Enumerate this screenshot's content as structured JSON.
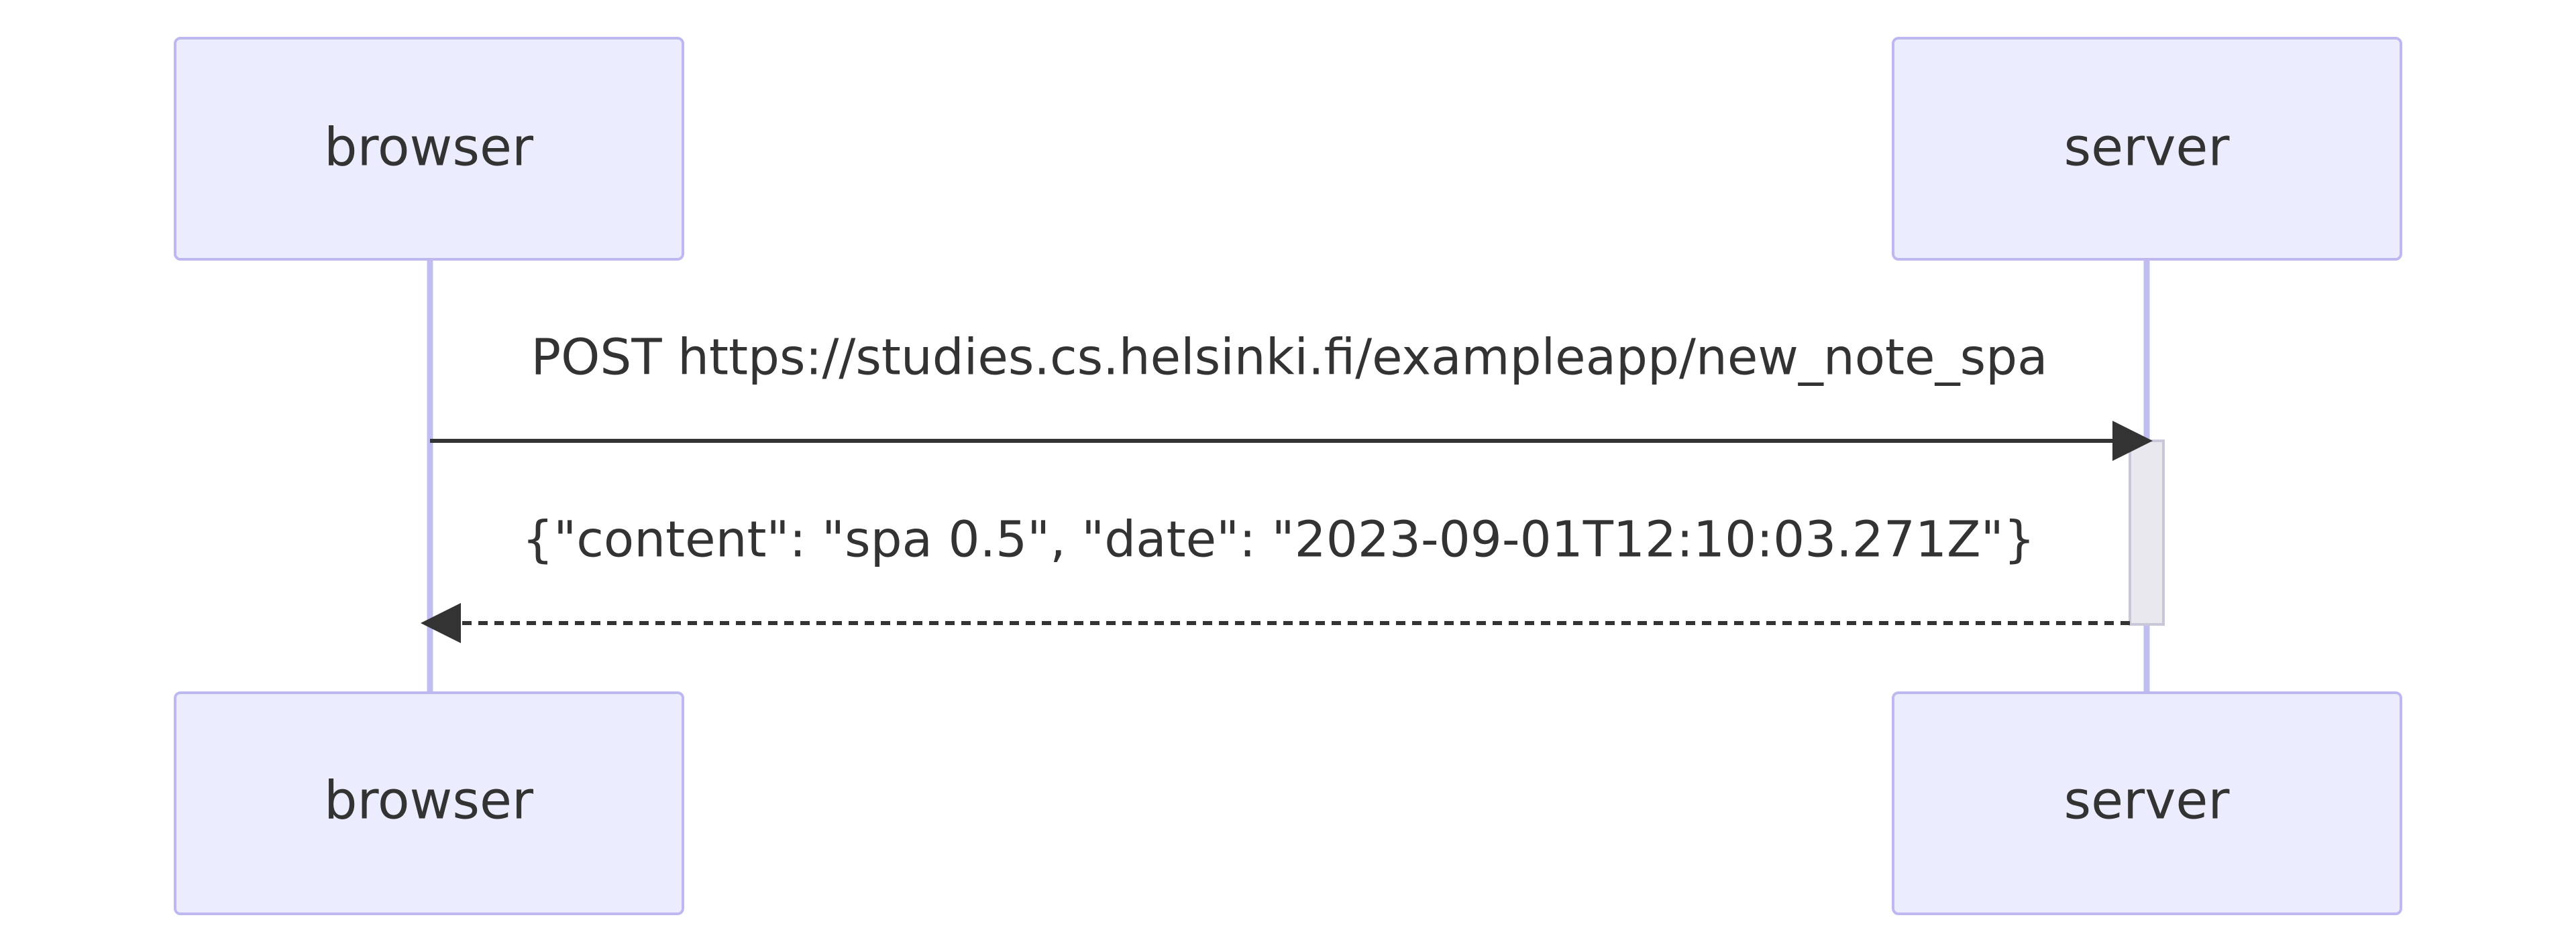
{
  "diagram": {
    "type": "sequence",
    "participants": [
      {
        "id": "browser",
        "label": "browser"
      },
      {
        "id": "server",
        "label": "server"
      }
    ],
    "messages": [
      {
        "from": "browser",
        "to": "server",
        "label": "POST https://studies.cs.helsinki.fi/exampleapp/new_note_spa",
        "style": "solid"
      },
      {
        "from": "server",
        "to": "browser",
        "label": "{\"content\": \"spa 0.5\", \"date\": \"2023-09-01T12:10:03.271Z\"}",
        "style": "dashed"
      }
    ],
    "activation": {
      "participant": "server"
    }
  },
  "colors": {
    "actor_fill": "#ECECFF",
    "actor_border": "#9370DB",
    "lifeline": "#C0BEF0",
    "arrow": "#333333",
    "activation_fill": "#E8E8EE",
    "activation_border": "#C8C8D8",
    "text": "#333333"
  }
}
